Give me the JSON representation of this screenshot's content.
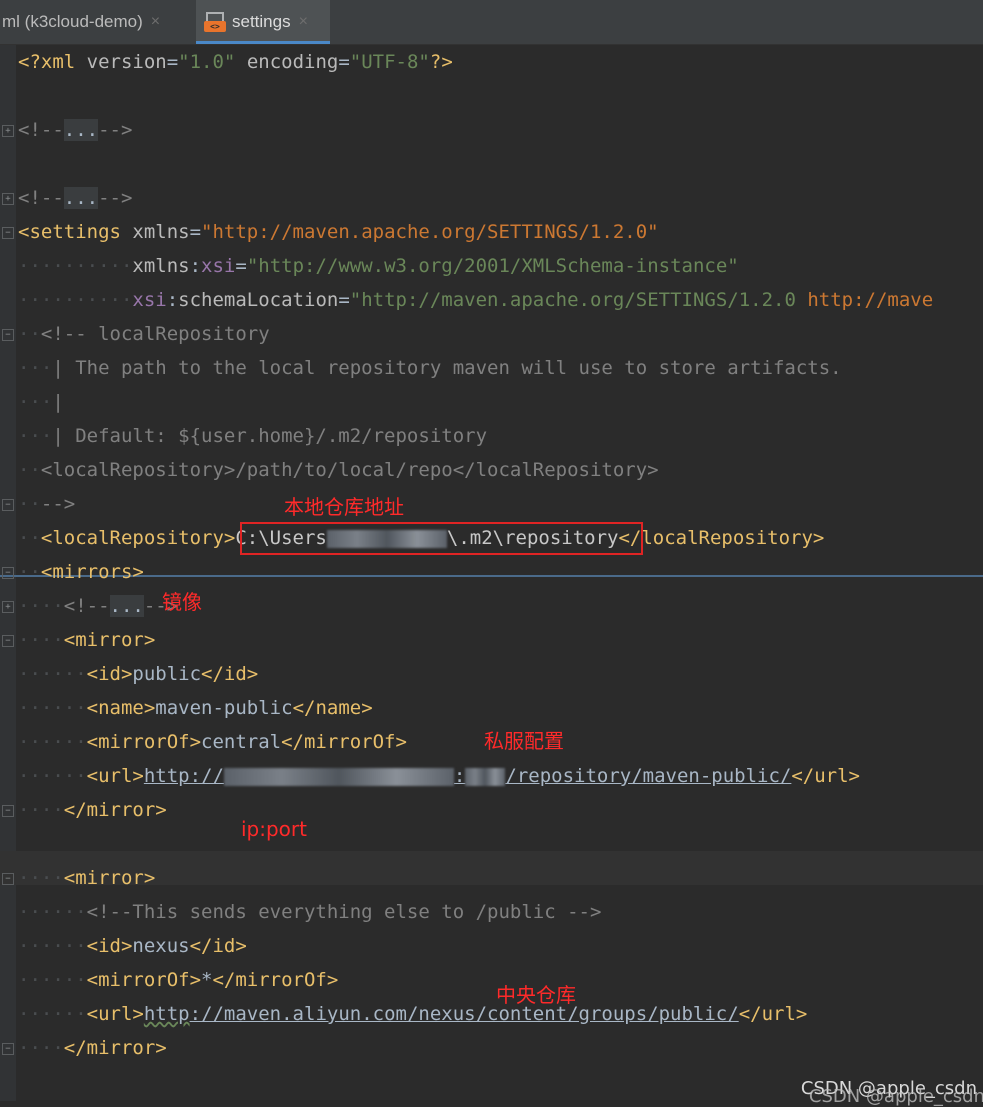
{
  "tabs": [
    {
      "label": "ml (k3cloud-demo)",
      "active": false
    },
    {
      "label": "settings",
      "active": true
    }
  ],
  "tab_close_glyph": "×",
  "xml_icon_label": "<>",
  "lines": [
    {
      "fold": null,
      "tokens": [
        [
          "t-tag",
          "<?xml "
        ],
        [
          "t-attr",
          "version"
        ],
        [
          "t-txt",
          "="
        ],
        [
          "t-str",
          "\"1.0\""
        ],
        [
          "t-txt",
          " "
        ],
        [
          "t-attr",
          "encoding"
        ],
        [
          "t-txt",
          "="
        ],
        [
          "t-str",
          "\"UTF-8\""
        ],
        [
          "t-tag",
          "?>"
        ]
      ]
    },
    {
      "fold": null,
      "tokens": []
    },
    {
      "fold": "+",
      "tokens": [
        [
          "t-cmt",
          "<!--"
        ],
        [
          "t-fold",
          "..."
        ],
        [
          "t-cmt",
          "-->"
        ]
      ]
    },
    {
      "fold": null,
      "tokens": []
    },
    {
      "fold": "+",
      "tokens": [
        [
          "t-cmt",
          "<!--"
        ],
        [
          "t-fold",
          "..."
        ],
        [
          "t-cmt",
          "-->"
        ]
      ]
    },
    {
      "fold": "-",
      "tokens": [
        [
          "t-tag",
          "<settings "
        ],
        [
          "t-attr",
          "xmlns"
        ],
        [
          "t-txt",
          "="
        ],
        [
          "t-url",
          "\"http://maven.apache.org/SETTINGS/1.2.0\""
        ]
      ]
    },
    {
      "fold": null,
      "tokens": [
        [
          "ws",
          "··········"
        ],
        [
          "t-attr",
          "xmlns"
        ],
        [
          "t-txt",
          ":"
        ],
        [
          "t-ns",
          "xsi"
        ],
        [
          "t-txt",
          "="
        ],
        [
          "t-str",
          "\"http://www.w3.org/2001/XMLSchema-instance\""
        ]
      ]
    },
    {
      "fold": null,
      "tokens": [
        [
          "ws",
          "··········"
        ],
        [
          "t-ns",
          "xsi"
        ],
        [
          "t-txt",
          ":"
        ],
        [
          "t-attr",
          "schemaLocation"
        ],
        [
          "t-txt",
          "="
        ],
        [
          "t-str",
          "\"http://maven.apache.org/SETTINGS/1.2.0 "
        ],
        [
          "t-url",
          "http://mave"
        ]
      ]
    },
    {
      "fold": "-",
      "tokens": [
        [
          "ws",
          "··"
        ],
        [
          "t-cmt",
          "<!-- localRepository"
        ]
      ]
    },
    {
      "fold": null,
      "tokens": [
        [
          "ws",
          "···"
        ],
        [
          "t-cmt",
          "| The path to the local repository maven will use to store artifacts."
        ]
      ]
    },
    {
      "fold": null,
      "tokens": [
        [
          "ws",
          "···"
        ],
        [
          "t-cmt",
          "|"
        ]
      ]
    },
    {
      "fold": null,
      "tokens": [
        [
          "ws",
          "···"
        ],
        [
          "t-cmt",
          "| Default: ${user.home}/.m2/repository"
        ]
      ]
    },
    {
      "fold": null,
      "tokens": [
        [
          "ws",
          "··"
        ],
        [
          "t-cmt",
          "<localRepository>/path/to/local/repo</localRepository>"
        ]
      ]
    },
    {
      "fold": "-",
      "tokens": [
        [
          "ws",
          "··"
        ],
        [
          "t-cmt",
          "-->"
        ]
      ]
    },
    {
      "fold": null,
      "tokens": [
        [
          "ws",
          "··"
        ],
        [
          "t-tag",
          "<localRepository>"
        ],
        [
          "t-dim",
          "C:\\Users"
        ],
        [
          "blur",
          ""
        ],
        [
          "t-dim",
          "\\.m2\\repository"
        ],
        [
          "t-tag",
          "</localRepository>"
        ]
      ]
    },
    {
      "fold": "-",
      "tokens": [
        [
          "ws",
          "··"
        ],
        [
          "t-tag",
          "<mirrors>"
        ]
      ]
    },
    {
      "fold": "+",
      "tokens": [
        [
          "ws",
          "····"
        ],
        [
          "t-cmt",
          "<!--"
        ],
        [
          "t-fold",
          "..."
        ],
        [
          "t-cmt",
          "-->"
        ]
      ]
    },
    {
      "fold": "-",
      "tokens": [
        [
          "ws",
          "····"
        ],
        [
          "t-tag",
          "<mirror>"
        ]
      ]
    },
    {
      "fold": null,
      "tokens": [
        [
          "ws",
          "······"
        ],
        [
          "t-tag",
          "<id>"
        ],
        [
          "t-txt",
          "public"
        ],
        [
          "t-tag",
          "</id>"
        ]
      ]
    },
    {
      "fold": null,
      "tokens": [
        [
          "ws",
          "······"
        ],
        [
          "t-tag",
          "<name>"
        ],
        [
          "t-txt",
          "maven-public"
        ],
        [
          "t-tag",
          "</name>"
        ]
      ]
    },
    {
      "fold": null,
      "tokens": [
        [
          "ws",
          "······"
        ],
        [
          "t-tag",
          "<mirrorOf>"
        ],
        [
          "t-txt",
          "central"
        ],
        [
          "t-tag",
          "</mirrorOf>"
        ]
      ]
    },
    {
      "fold": null,
      "tokens": [
        [
          "ws",
          "······"
        ],
        [
          "t-tag",
          "<url>"
        ],
        [
          "t-link",
          "http://"
        ],
        [
          "blur",
          ""
        ],
        [
          "t-link",
          ":"
        ],
        [
          "blur",
          ""
        ],
        [
          "t-link",
          "/repository/maven-public/"
        ],
        [
          "t-tag",
          "</url>"
        ]
      ]
    },
    {
      "fold": "-",
      "tokens": [
        [
          "ws",
          "····"
        ],
        [
          "t-tag",
          "</mirror>"
        ]
      ]
    },
    {
      "fold": null,
      "tokens": []
    },
    {
      "fold": "-",
      "tokens": [
        [
          "ws",
          "····"
        ],
        [
          "t-tag",
          "<mirror>"
        ]
      ]
    },
    {
      "fold": null,
      "tokens": [
        [
          "ws",
          "······"
        ],
        [
          "t-cmt",
          "<!--This sends everything else to /public -->"
        ]
      ]
    },
    {
      "fold": null,
      "tokens": [
        [
          "ws",
          "······"
        ],
        [
          "t-tag",
          "<id>"
        ],
        [
          "t-txt",
          "nexus"
        ],
        [
          "t-tag",
          "</id>"
        ]
      ]
    },
    {
      "fold": null,
      "tokens": [
        [
          "ws",
          "······"
        ],
        [
          "t-tag",
          "<mirrorOf>"
        ],
        [
          "t-txt",
          "*"
        ],
        [
          "t-tag",
          "</mirrorOf>"
        ]
      ]
    },
    {
      "fold": null,
      "tokens": [
        [
          "ws",
          "······"
        ],
        [
          "t-tag",
          "<url>"
        ],
        [
          "t-link wavy",
          "http"
        ],
        [
          "t-link",
          "://maven.aliyun.com/nexus/content/groups/public/"
        ],
        [
          "t-tag",
          "</url>"
        ]
      ]
    },
    {
      "fold": "-",
      "tokens": [
        [
          "ws",
          "····"
        ],
        [
          "t-tag",
          "</mirror>"
        ]
      ]
    }
  ],
  "annotations": {
    "local_repo": "本地仓库地址",
    "mirrors": "镜像",
    "private_server": "私服配置",
    "ip_port": "ip:port",
    "central_repo": "中央仓库"
  },
  "watermark": "CSDN @apple_csdn"
}
